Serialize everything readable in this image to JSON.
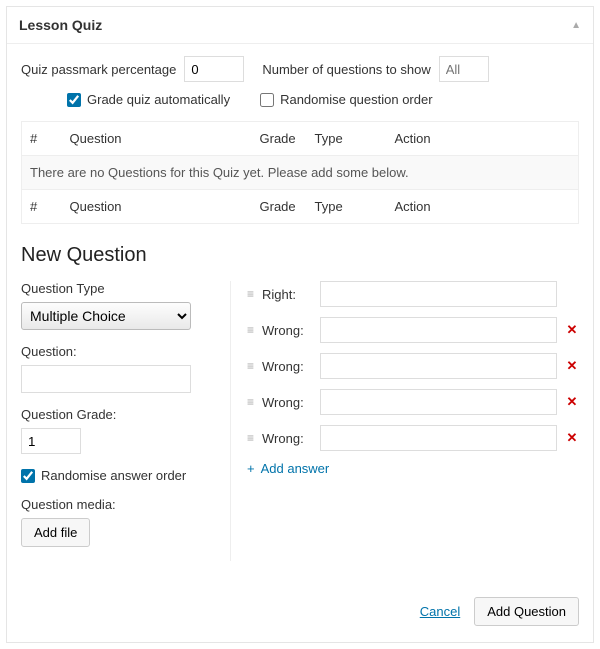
{
  "panel": {
    "title": "Lesson Quiz"
  },
  "settings": {
    "passmark_label": "Quiz passmark percentage",
    "passmark_value": "0",
    "num_questions_label": "Number of questions to show",
    "num_questions_placeholder": "All",
    "grade_auto_label": "Grade quiz automatically",
    "grade_auto_checked": true,
    "randomise_label": "Randomise question order",
    "randomise_checked": false
  },
  "table": {
    "headers": {
      "num": "#",
      "question": "Question",
      "grade": "Grade",
      "type": "Type",
      "action": "Action"
    },
    "empty_message": "There are no Questions for this Quiz yet. Please add some below."
  },
  "new_question": {
    "heading": "New Question",
    "type_label": "Question Type",
    "type_value": "Multiple Choice",
    "question_label": "Question:",
    "question_value": "",
    "grade_label": "Question Grade:",
    "grade_value": "1",
    "rand_answer_label": "Randomise answer order",
    "rand_answer_checked": true,
    "media_label": "Question media:",
    "add_file_label": "Add file",
    "answers": [
      {
        "label": "Right:",
        "value": "",
        "removable": false
      },
      {
        "label": "Wrong:",
        "value": "",
        "removable": true
      },
      {
        "label": "Wrong:",
        "value": "",
        "removable": true
      },
      {
        "label": "Wrong:",
        "value": "",
        "removable": true
      },
      {
        "label": "Wrong:",
        "value": "",
        "removable": true
      }
    ],
    "add_answer_label": "Add answer"
  },
  "actions": {
    "cancel": "Cancel",
    "add_question": "Add Question"
  }
}
